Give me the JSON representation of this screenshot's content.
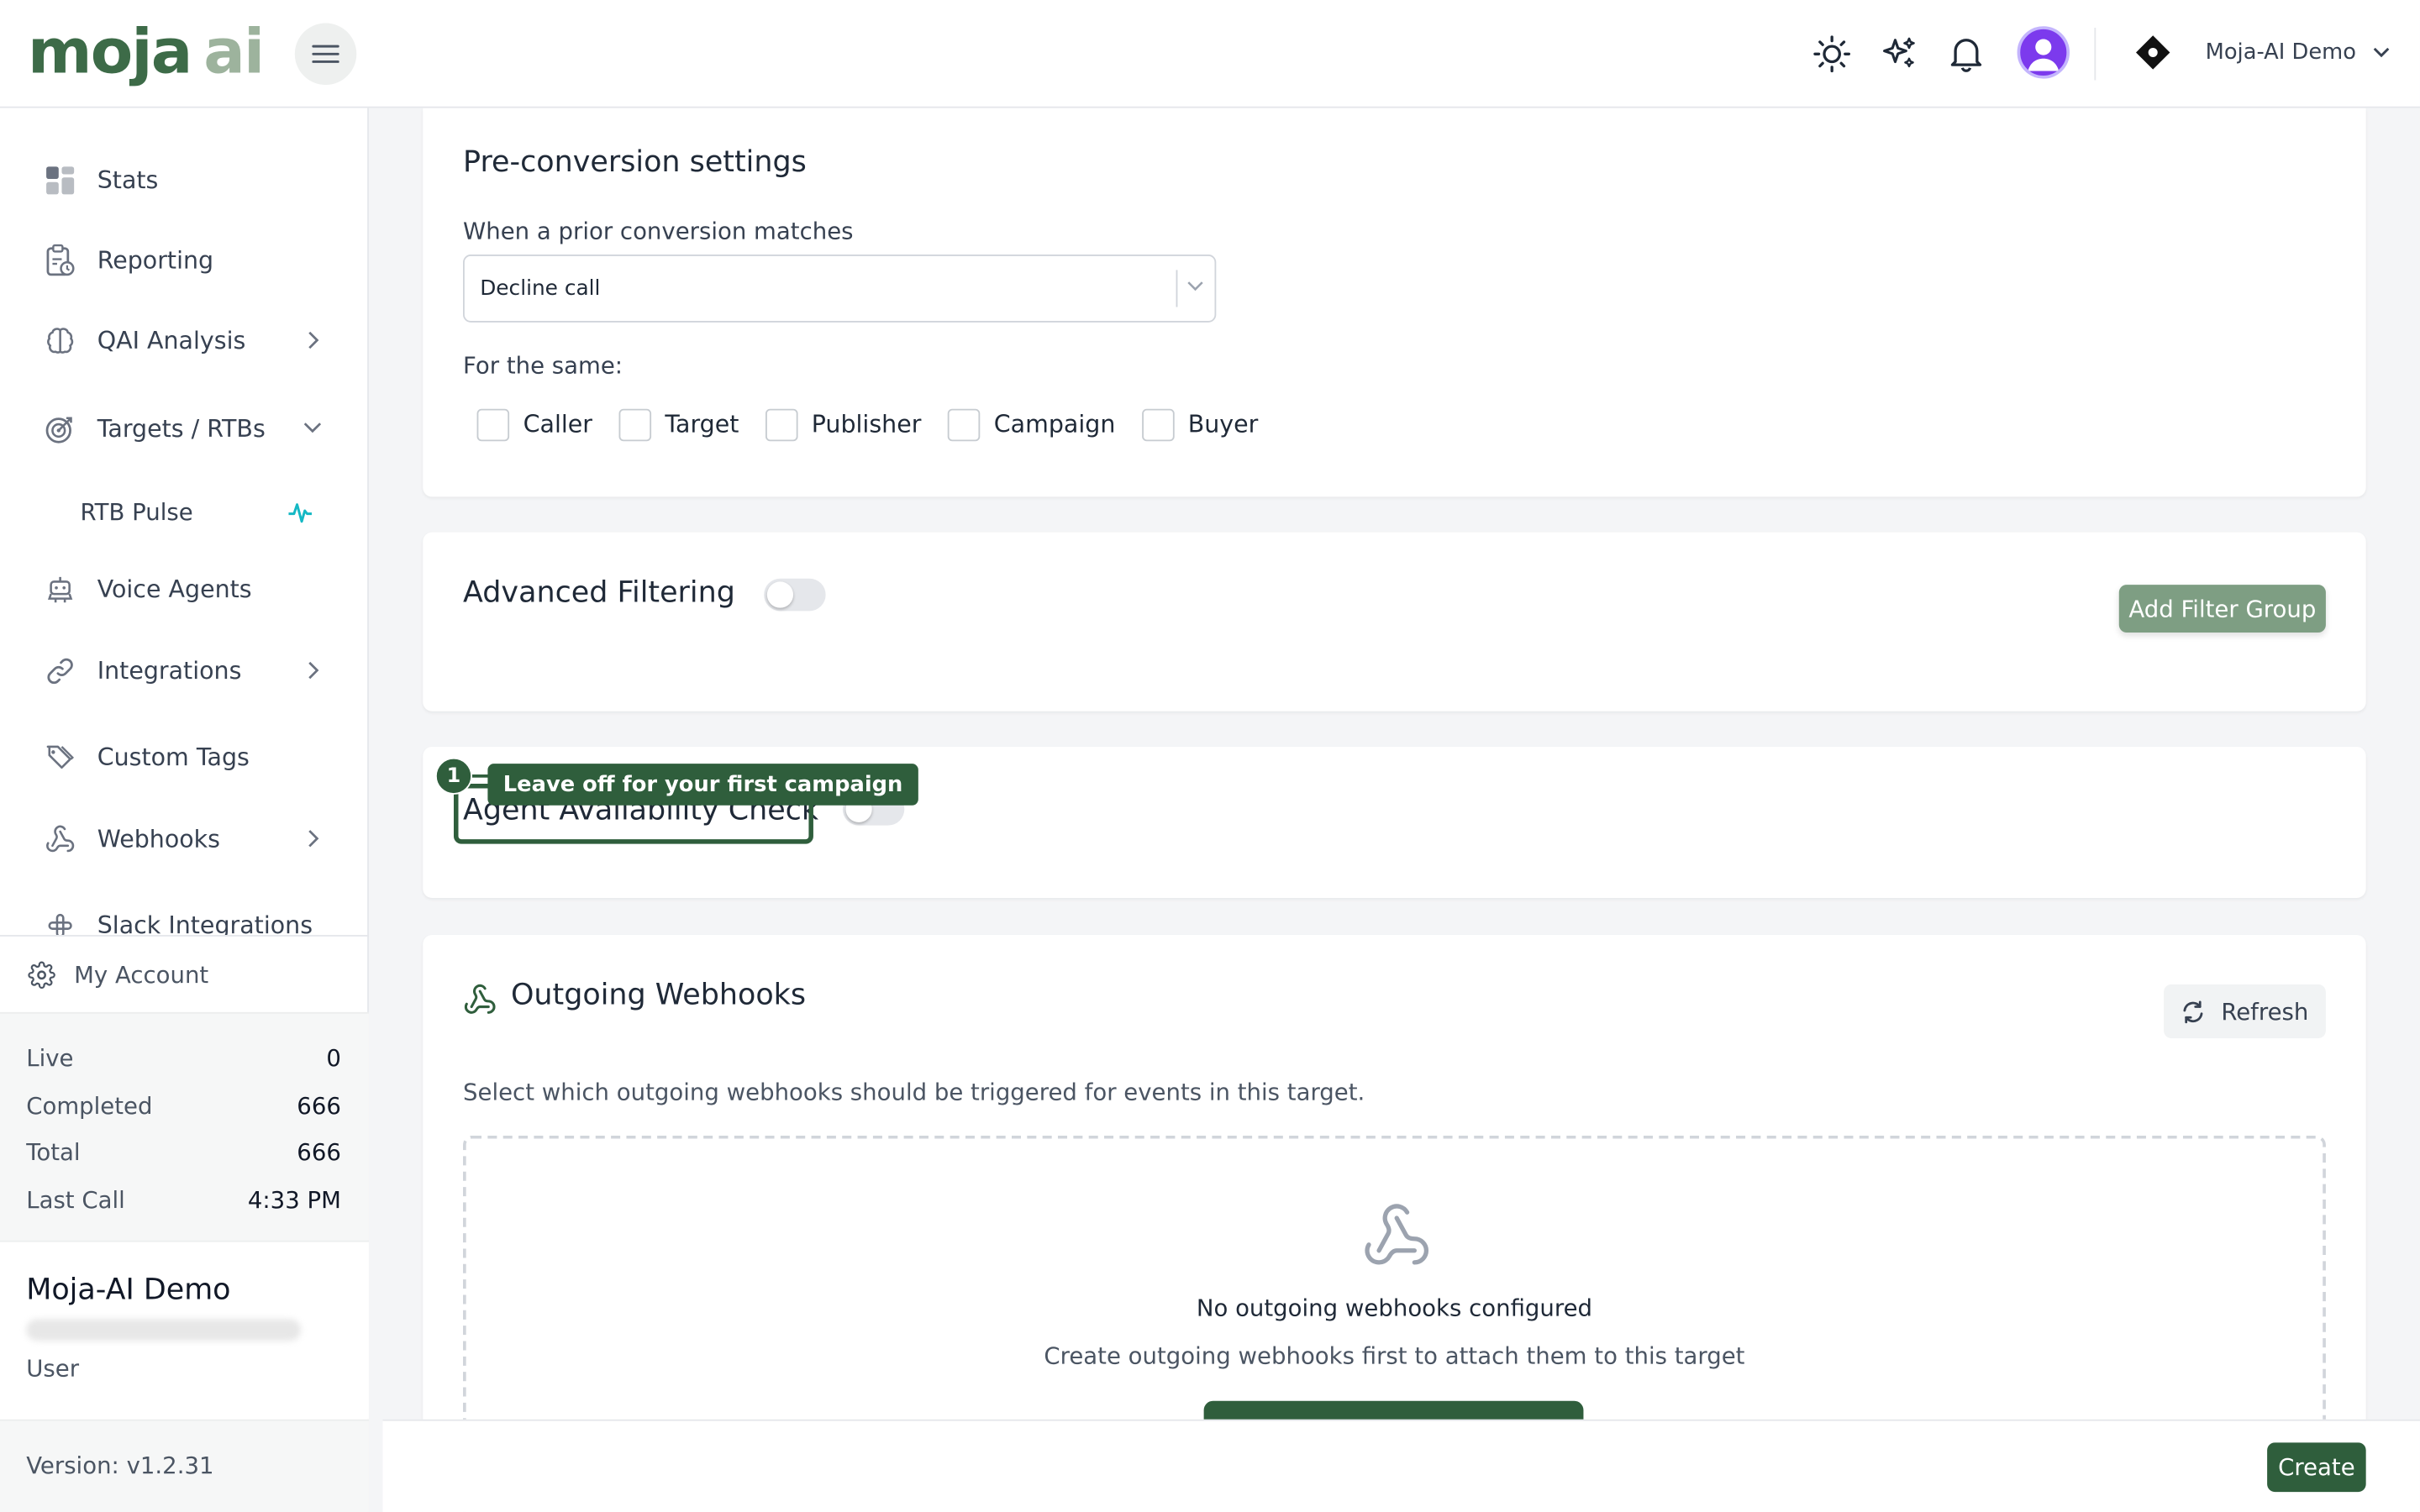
{
  "header": {
    "logo_primary": "moja",
    "logo_secondary": "ai",
    "org_name": "Moja-AI Demo"
  },
  "sidebar": {
    "items": [
      {
        "label": "Stats",
        "icon": "grid-icon"
      },
      {
        "label": "Reporting",
        "icon": "clipboard-clock-icon"
      },
      {
        "label": "QAI Analysis",
        "icon": "brain-icon"
      },
      {
        "label": "Targets / RTBs",
        "icon": "target-icon"
      },
      {
        "label": "RTB Pulse",
        "icon": "pulse-icon"
      },
      {
        "label": "Voice Agents",
        "icon": "robot-icon"
      },
      {
        "label": "Integrations",
        "icon": "link-icon"
      },
      {
        "label": "Custom Tags",
        "icon": "tags-icon"
      },
      {
        "label": "Webhooks",
        "icon": "webhook-icon"
      },
      {
        "label": "Slack Integrations",
        "icon": "slack-icon"
      }
    ],
    "account_label": "My Account",
    "stats": [
      {
        "label": "Live",
        "value": "0"
      },
      {
        "label": "Completed",
        "value": "666"
      },
      {
        "label": "Total",
        "value": "666"
      },
      {
        "label": "Last Call",
        "value": "4:33 PM"
      }
    ],
    "user_name": "Moja-AI Demo",
    "user_role": "User",
    "version": "Version: v1.2.31"
  },
  "preconversion": {
    "title": "Pre-conversion settings",
    "match_label": "When a prior conversion matches",
    "match_value": "Decline call",
    "same_label": "For the same:",
    "checkboxes": [
      "Caller",
      "Target",
      "Publisher",
      "Campaign",
      "Buyer"
    ]
  },
  "advanced": {
    "title": "Advanced Filtering",
    "add_button": "Add Filter Group"
  },
  "agent_check": {
    "title": "Agent Availability Check",
    "tour_step": "1",
    "tour_tip": "Leave off for your first campaign"
  },
  "webhooks": {
    "title": "Outgoing Webhooks",
    "refresh_button": "Refresh",
    "description": "Select which outgoing webhooks should be triggered for events in this target.",
    "empty_title": "No outgoing webhooks configured",
    "empty_sub": "Create outgoing webhooks first to attach them to this target"
  },
  "footer": {
    "create_button": "Create"
  },
  "colors": {
    "brand_green": "#2f5e3c",
    "logo_light": "#9db39d",
    "filter_button": "#7e9e83",
    "avatar": "#7c3aed",
    "pulse_accent": "#14b8c4"
  }
}
